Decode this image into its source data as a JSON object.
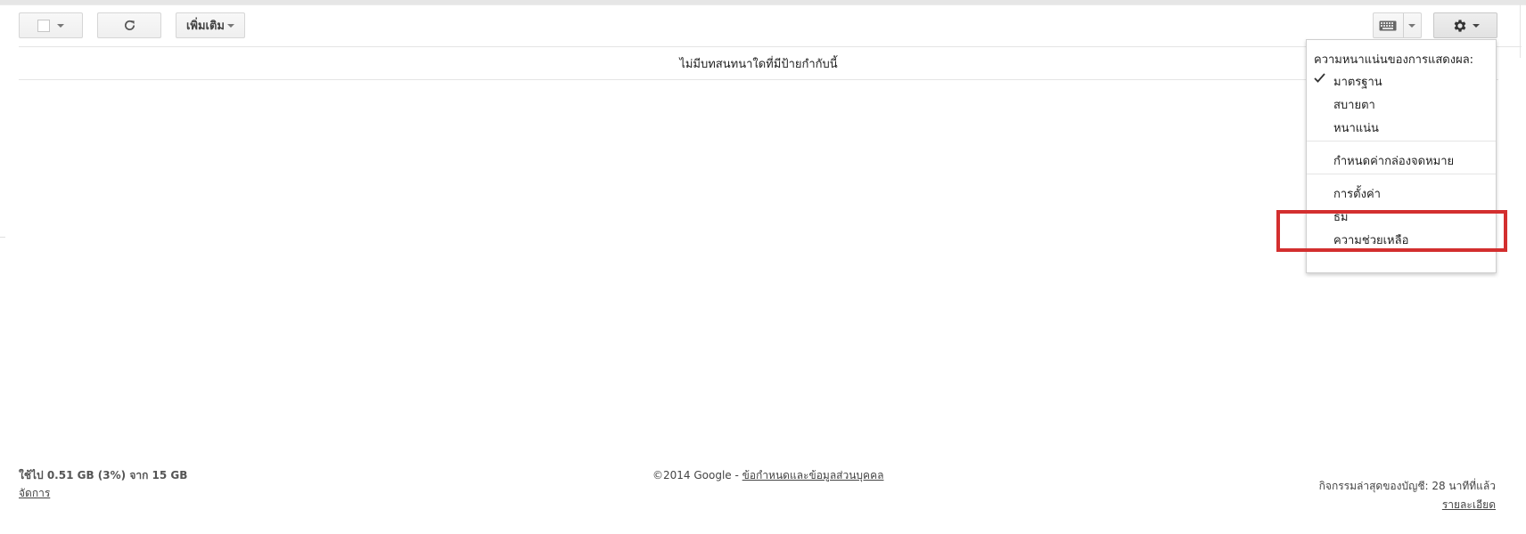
{
  "toolbar": {
    "more_label": "เพิ่มเติม"
  },
  "list": {
    "empty_message": "ไม่มีบทสนทนาใดที่มีป้ายกำกับนี้"
  },
  "settings_menu": {
    "density_heading": "ความหนาแน่นของการแสดงผล:",
    "density_options": [
      {
        "label": "มาตรฐาน",
        "selected": true
      },
      {
        "label": "สบายตา",
        "selected": false
      },
      {
        "label": "หนาแน่น",
        "selected": false
      }
    ],
    "configure_inbox": "กำหนดค่ากล่องจดหมาย",
    "settings": "การตั้งค่า",
    "themes": "ธีม",
    "help": "ความช่วยเหลือ"
  },
  "footer": {
    "storage_usage": "ใช้ไป 0.51 GB (3%) จาก 15 GB",
    "manage_link": "จัดการ",
    "copyright": "©2014 Google - ",
    "terms_link": "ข้อกำหนดและข้อมูลส่วนบุคคล",
    "last_activity": "กิจกรรมล่าสุดของบัญชี: 28 นาทีที่แล้ว",
    "details_link": "รายละเอียด"
  },
  "colors": {
    "highlight": "#d32f2f"
  },
  "icons": [
    "checkbox-icon",
    "refresh-icon",
    "keyboard-icon",
    "gear-icon",
    "check-icon",
    "caret-down-icon"
  ]
}
